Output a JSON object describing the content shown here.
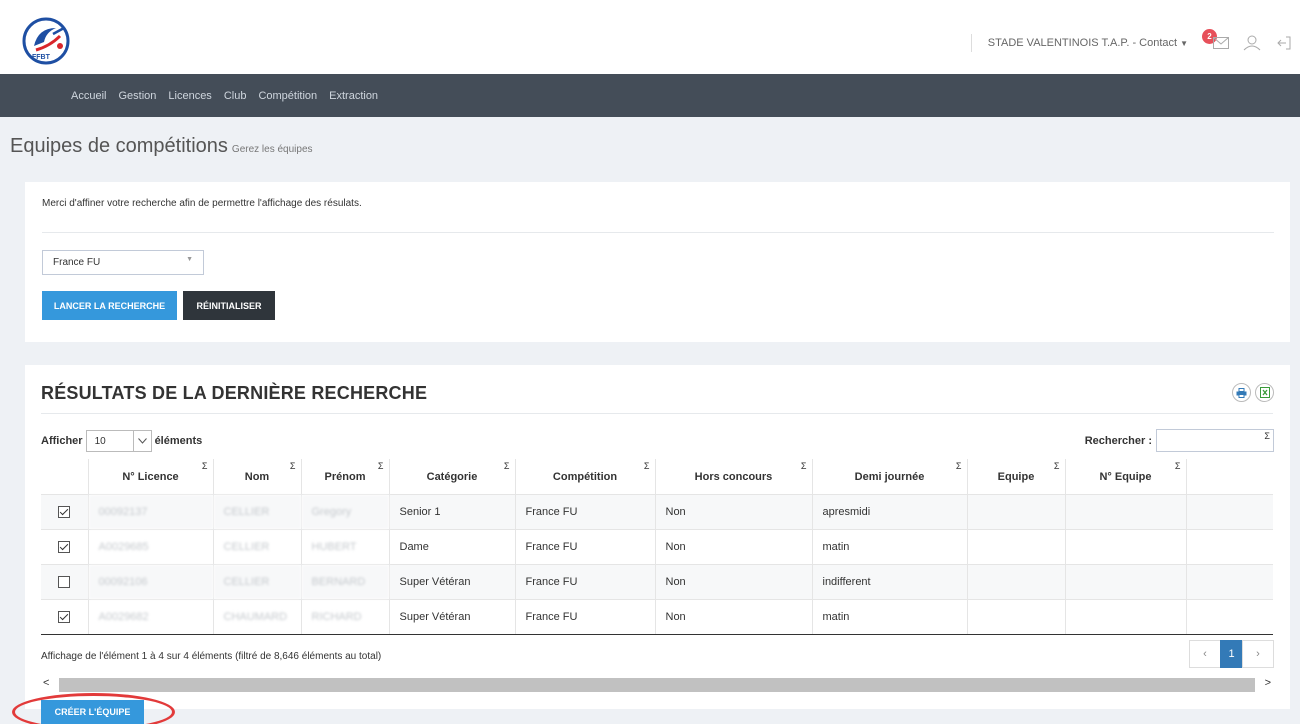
{
  "header": {
    "club_contact": "STADE VALENTINOIS T.A.P. - Contact",
    "notification_count": "2",
    "logo_text": "FFBT"
  },
  "nav": {
    "items": [
      {
        "label": "Accueil"
      },
      {
        "label": "Gestion"
      },
      {
        "label": "Licences"
      },
      {
        "label": "Club"
      },
      {
        "label": "Compétition"
      },
      {
        "label": "Extraction"
      }
    ]
  },
  "page": {
    "title": "Equipes de compétitions",
    "subtitle": "Gerez les équipes"
  },
  "search_panel": {
    "message": "Merci d'affiner votre recherche afin de permettre l'affichage des résulats.",
    "competition_select_value": "France FU",
    "launch_button": "LANCER LA RECHERCHE",
    "reset_button": "RÉINITIALISER"
  },
  "results": {
    "title": "RÉSULTATS DE LA DERNIÈRE RECHERCHE",
    "show_label": "Afficher",
    "page_length": "10",
    "elements_label": "éléments",
    "search_label": "Rechercher :",
    "sigma": "Σ",
    "columns": [
      "N° Licence",
      "Nom",
      "Prénom",
      "Catégorie",
      "Compétition",
      "Hors concours",
      "Demi journée",
      "Equipe",
      "N° Equipe"
    ],
    "rows": [
      {
        "checked": true,
        "licence": "00092137",
        "nom": "CELLIER",
        "prenom": "Gregory",
        "categorie": "Senior 1",
        "competition": "France FU",
        "hors_concours": "Non",
        "demi_journee": "apresmidi",
        "equipe": "",
        "num_equipe": ""
      },
      {
        "checked": true,
        "licence": "A0029685",
        "nom": "CELLIER",
        "prenom": "HUBERT",
        "categorie": "Dame",
        "competition": "France FU",
        "hors_concours": "Non",
        "demi_journee": "matin",
        "equipe": "",
        "num_equipe": ""
      },
      {
        "checked": false,
        "licence": "00092106",
        "nom": "CELLIER",
        "prenom": "BERNARD",
        "categorie": "Super Vétéran",
        "competition": "France FU",
        "hors_concours": "Non",
        "demi_journee": "indifferent",
        "equipe": "",
        "num_equipe": ""
      },
      {
        "checked": true,
        "licence": "A0029682",
        "nom": "CHAUMARD",
        "prenom": "RICHARD",
        "categorie": "Super Vétéran",
        "competition": "France FU",
        "hors_concours": "Non",
        "demi_journee": "matin",
        "equipe": "",
        "num_equipe": ""
      }
    ],
    "info": "Affichage de l'élément 1 à 4 sur 4 éléments (filtré de 8,646 éléments au total)",
    "pagination": {
      "prev": "‹",
      "current": "1",
      "next": "›"
    },
    "scroll_left": "<",
    "scroll_right": ">"
  },
  "actions": {
    "create_team_button": "CRÉER L'ÉQUIPE"
  },
  "colors": {
    "navbar": "#444d58",
    "primary_blue": "#3598dc",
    "dark_button": "#2f353b",
    "badge_red": "#e7505a",
    "annotation_red": "#e23a3a"
  }
}
